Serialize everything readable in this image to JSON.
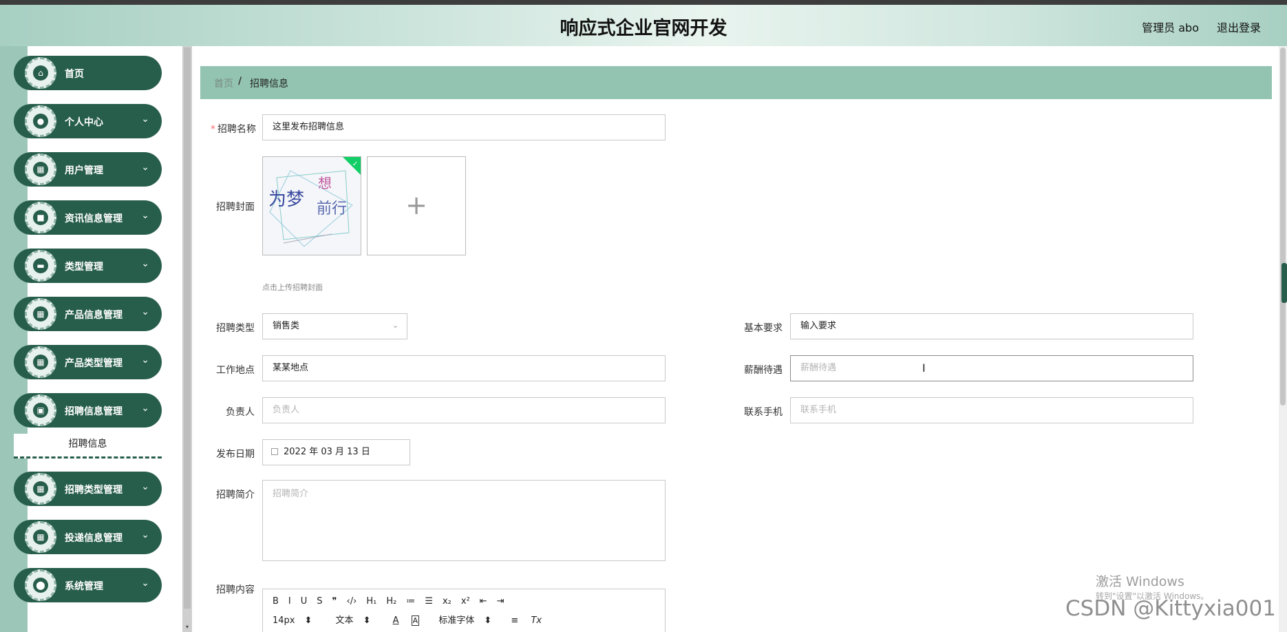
{
  "header": {
    "title": "响应式企业官网开发",
    "user": "管理员 abo",
    "logout": "退出登录"
  },
  "sidebar": {
    "items": [
      {
        "label": "首页",
        "icon": "home-icon",
        "glyph": "⌂",
        "has_chevron": false
      },
      {
        "label": "个人中心",
        "icon": "user-icon",
        "glyph": "●",
        "has_chevron": true
      },
      {
        "label": "用户管理",
        "icon": "grid-icon",
        "glyph": "▦",
        "has_chevron": true
      },
      {
        "label": "资讯信息管理",
        "icon": "briefcase-icon",
        "glyph": "■",
        "has_chevron": true
      },
      {
        "label": "类型管理",
        "icon": "monitor-icon",
        "glyph": "▬",
        "has_chevron": true
      },
      {
        "label": "产品信息管理",
        "icon": "grid-icon",
        "glyph": "▦",
        "has_chevron": true
      },
      {
        "label": "产品类型管理",
        "icon": "grid-icon",
        "glyph": "▦",
        "has_chevron": true
      },
      {
        "label": "招聘信息管理",
        "icon": "clipboard-icon",
        "glyph": "▣",
        "has_chevron": true
      },
      {
        "label": "招聘类型管理",
        "icon": "grid-icon",
        "glyph": "▦",
        "has_chevron": true
      },
      {
        "label": "投递信息管理",
        "icon": "grid-icon",
        "glyph": "▦",
        "has_chevron": true
      },
      {
        "label": "系统管理",
        "icon": "location-icon",
        "glyph": "⬤",
        "has_chevron": true
      }
    ],
    "submenu": "招聘信息",
    "chevron": "⌄"
  },
  "breadcrumb": {
    "home": "首页",
    "sep": "/",
    "current": "招聘信息"
  },
  "form": {
    "name": {
      "label": "招聘名称",
      "required": "*",
      "value": "这里发布招聘信息"
    },
    "cover": {
      "label": "招聘封面",
      "tip": "点击上传招聘封面",
      "add": "+"
    },
    "type": {
      "label": "招聘类型",
      "value": "销售类",
      "arrow": "⌄"
    },
    "requirement": {
      "label": "基本要求",
      "value": "输入要求"
    },
    "location": {
      "label": "工作地点",
      "value": "某某地点"
    },
    "salary": {
      "label": "薪酬待遇",
      "placeholder": "薪酬待遇"
    },
    "owner": {
      "label": "负责人",
      "placeholder": "负责人"
    },
    "phone": {
      "label": "联系手机",
      "placeholder": "联系手机"
    },
    "date": {
      "label": "发布日期",
      "value": "2022 年 03 月 13 日"
    },
    "intro": {
      "label": "招聘简介",
      "placeholder": "招聘简介"
    },
    "content": {
      "label": "招聘内容"
    }
  },
  "editor": {
    "row1": [
      "B",
      "I",
      "U",
      "S",
      "❞",
      "‹/›",
      "H₁",
      "H₂",
      "≔",
      "☰",
      "x₂",
      "x²",
      "⇤",
      "⇥"
    ],
    "size": "14px",
    "size_arrow": "⬍",
    "text": "文本",
    "text_arrow": "⬍",
    "color": "A",
    "bg": "A",
    "font": "标准字体",
    "font_arrow": "⬍",
    "align": "≡",
    "clear": "Tx"
  },
  "cursor": "I",
  "watermark": {
    "line1": "激活 Windows",
    "line2": "转到\"设置\"以激活 Windows。",
    "csdn": "CSDN @Kittyxia001"
  },
  "cover_image": {
    "text1": "为梦",
    "text2": "想",
    "text3": "前行"
  }
}
